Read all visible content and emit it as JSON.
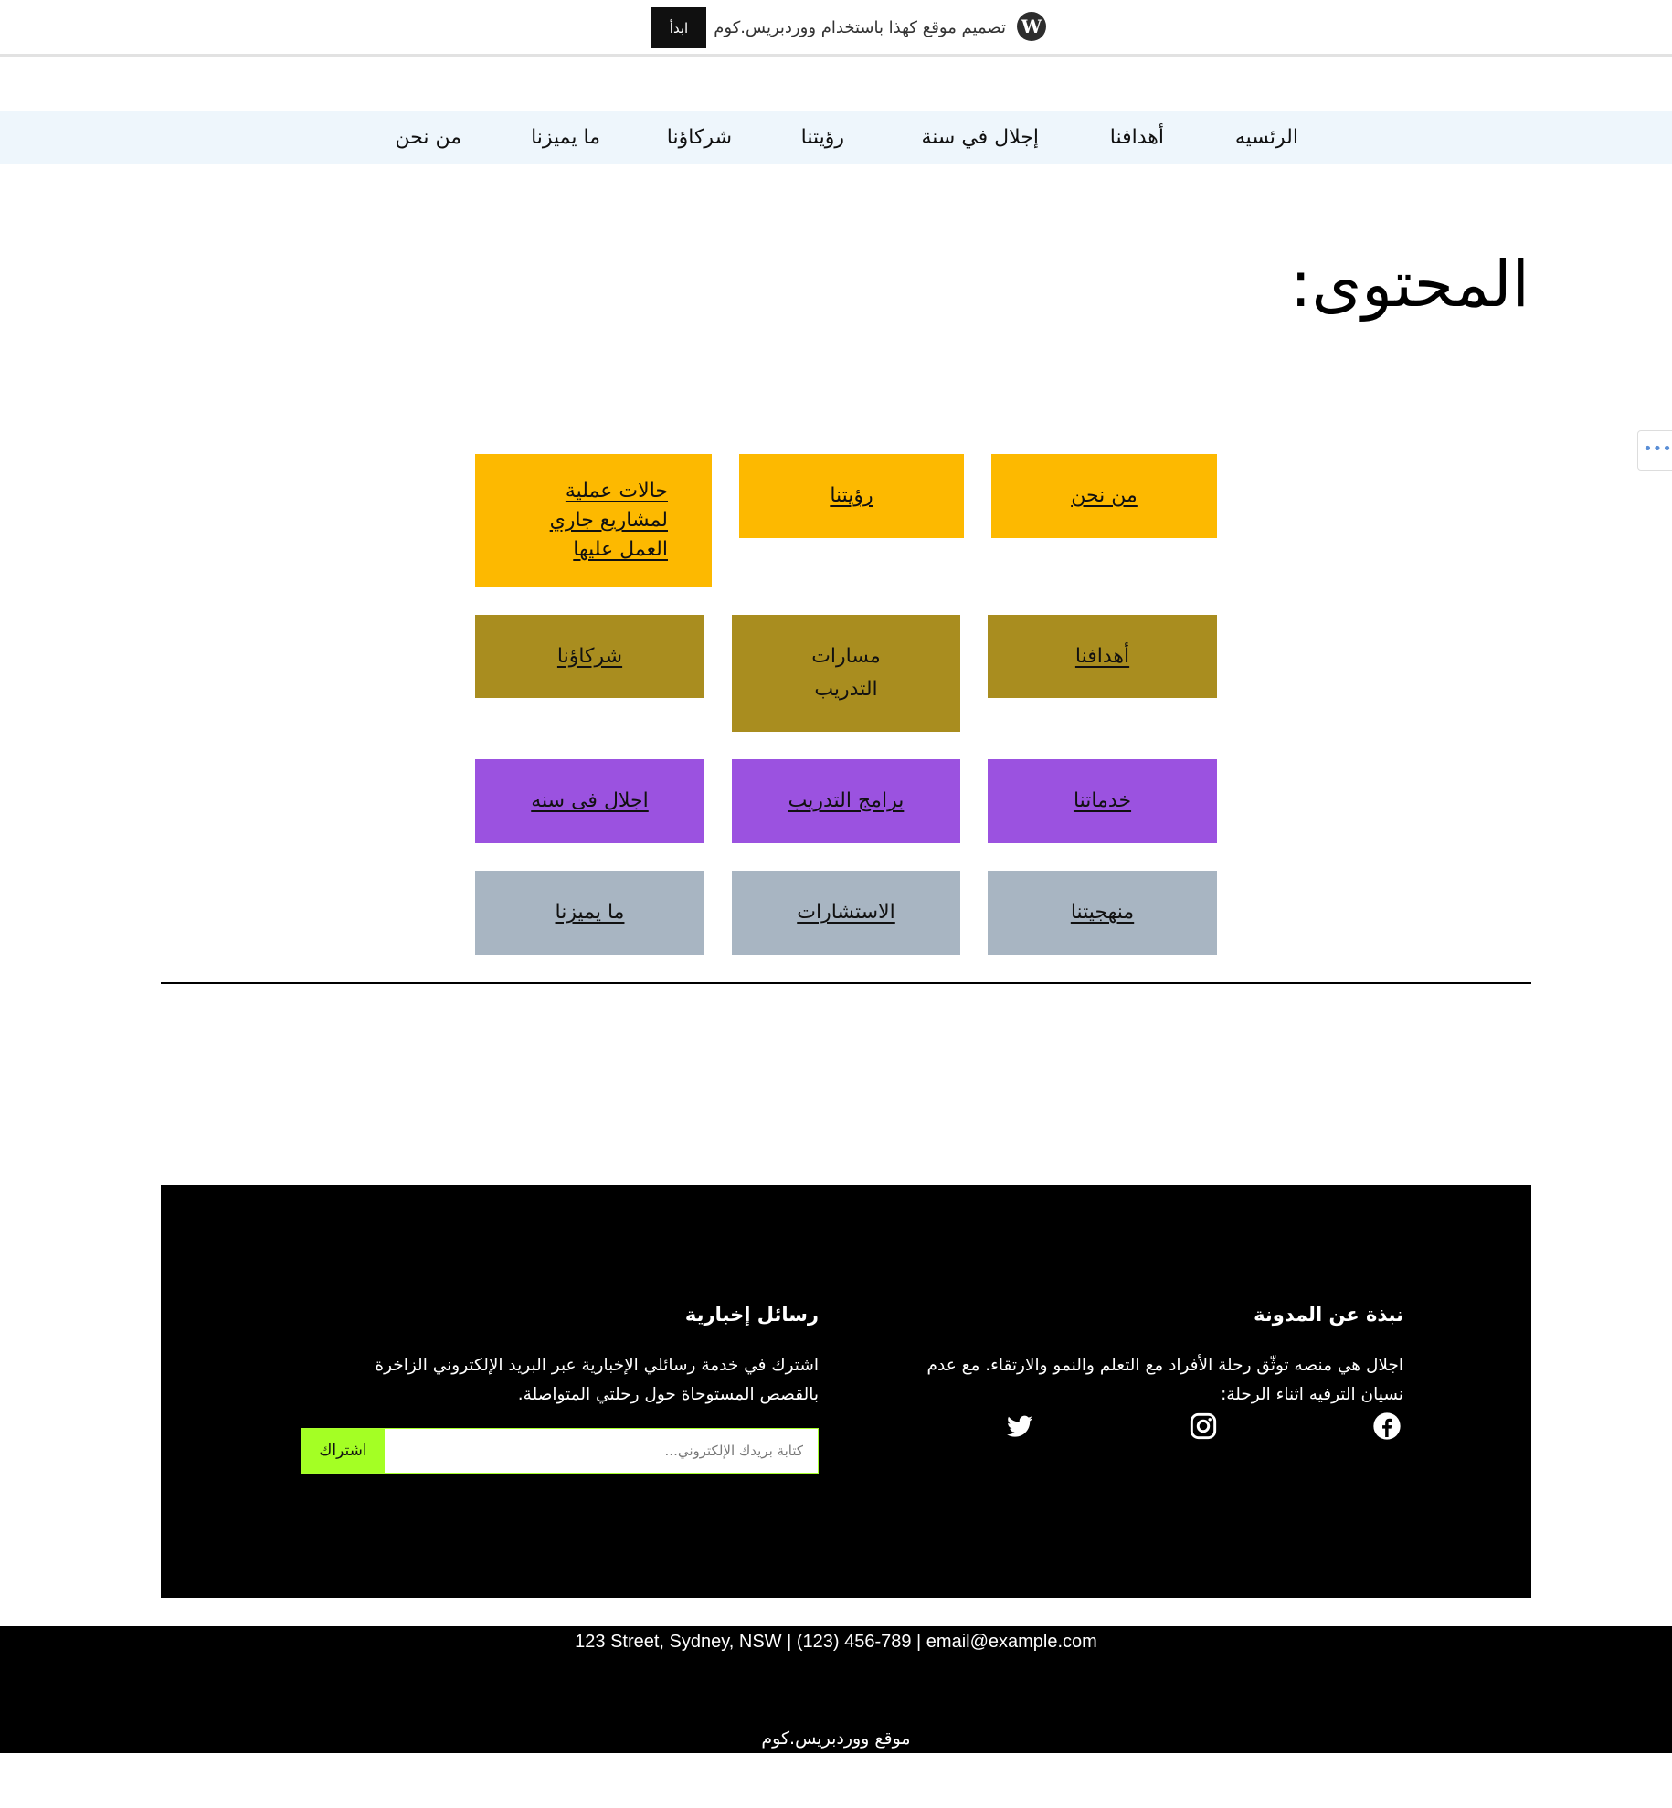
{
  "wpbar": {
    "text": "تصميم موقع كهذا باستخدام ووردبريس.كوم",
    "button": "ابدأ",
    "logo_icon": "wordpress-logo-icon"
  },
  "nav": {
    "items": [
      "الرئسيه",
      "أهدافنا",
      "إجلال في سنة",
      "رؤيتنا",
      "شركاؤنا",
      "ما يميزنا",
      "من نحن"
    ]
  },
  "page_title": "المحتوى:",
  "blocks": {
    "row1": [
      "من نحن",
      "رؤيتنا",
      "حالات عملية لمشاريع جاري العمل عليها"
    ],
    "row1_c3_lines": [
      "حالات عملية",
      "لمشاريع جاري",
      "العمل عليها"
    ],
    "row2": [
      "أهدافنا",
      "مسارات التدريب",
      "شركاؤنا"
    ],
    "row2_c2_lines": [
      "مسارات",
      "التدريب"
    ],
    "row3": [
      "خدماتنا",
      "برامج التدريب",
      "اجلال فى سنه"
    ],
    "row4": [
      "منهجيتنا",
      "الاستشارات",
      "ما يميزنا"
    ]
  },
  "colors": {
    "yellow": "#fdb900",
    "olive": "#a98d1f",
    "purple": "#9b52e0",
    "grey": "#a8b5c2",
    "subscribe_green": "#a4ff24"
  },
  "footer": {
    "about": {
      "heading": "نبذة عن المدونة",
      "text": "اجلال هي منصه توثّق رحلة الأفراد مع التعلم والنمو والارتقاء. مع عدم نسيان الترفيه اثناء الرحلة:"
    },
    "social_icons": [
      "facebook-icon",
      "instagram-icon",
      "twitter-icon"
    ],
    "newsletter": {
      "heading": "رسائل إخبارية",
      "text": "اشترك في خدمة رسائلي الإخبارية عبر البريد الإلكتروني الزاخرة بالقصص المستوحاة حول رحلتي المتواصلة.",
      "placeholder": "كتابة بريدك الإلكتروني...",
      "button": "اشتراك"
    }
  },
  "bottom": {
    "address": "123 Street, Sydney, NSW | (123) 456-789 | email@example.com",
    "credit": "موقع ووردبريس.كوم"
  },
  "side_button": "•••"
}
